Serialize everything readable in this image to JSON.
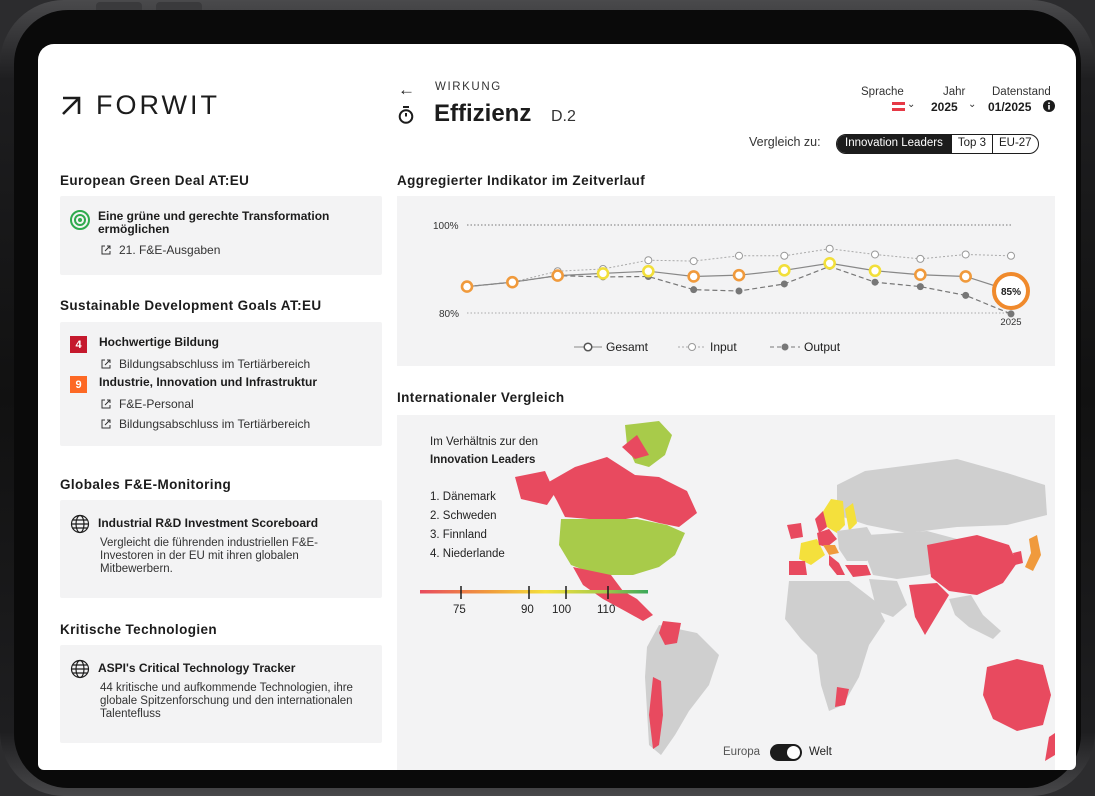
{
  "brand": {
    "name": "FORWIT"
  },
  "header": {
    "kicker": "WIRKUNG",
    "title": "Effizienz",
    "code": "D.2",
    "language_label": "Sprache",
    "year_label": "Jahr",
    "year_value": "2025",
    "data_label": "Datenstand",
    "data_value": "01/2025"
  },
  "compare": {
    "label": "Vergleich zu:",
    "options": [
      "Innovation Leaders",
      "Top 3",
      "EU-27"
    ],
    "selected": "Innovation Leaders"
  },
  "sidebar": {
    "green_deal": {
      "title": "European Green Deal AT:EU",
      "goal": "Eine grüne und gerechte Transformation ermöglichen",
      "link": "21. F&E-Ausgaben"
    },
    "sdg": {
      "title": "Sustainable Development Goals AT:EU",
      "goals": [
        {
          "num": "4",
          "label": "Hochwertige Bildung",
          "color": "#c5192d",
          "links": [
            "Bildungsabschluss im Tertiärbereich"
          ]
        },
        {
          "num": "9",
          "label": "Industrie, Innovation und Infrastruktur",
          "color": "#fd6925",
          "links": [
            "F&E-Personal",
            "Bildungsabschluss im Tertiärbereich"
          ]
        }
      ]
    },
    "monitoring": {
      "title": "Globales F&E-Monitoring",
      "item_title": "Industrial R&D Investment Scoreboard",
      "item_text": "Vergleicht die führenden industriellen F&E-Investoren in der EU mit ihren globalen Mitbewerbern."
    },
    "tech": {
      "title": "Kritische Technologien",
      "item_title": "ASPI's Critical Technology Tracker",
      "item_text": "44 kritische und aufkommende Technologien, ihre globale Spitzenforschung und den internationalen Talentefluss"
    }
  },
  "chart_data": {
    "type": "line",
    "title": "Aggregierter Indikator im Zeitverlauf",
    "y_ticks": [
      "100%",
      "80%"
    ],
    "ylim": [
      78,
      102
    ],
    "highlight_label": "85%",
    "year_label": "2025",
    "series": [
      {
        "name": "Gesamt",
        "values": [
          86,
          87,
          88.5,
          89,
          89.5,
          88.3,
          88.6,
          89.7,
          91.3,
          89.6,
          88.7,
          88.3,
          85
        ]
      },
      {
        "name": "Input",
        "values": [
          86,
          87,
          89.5,
          90,
          92,
          91.8,
          93,
          93,
          94.6,
          93.3,
          92.3,
          93.3,
          93
        ]
      },
      {
        "name": "Output",
        "values": [
          86,
          87,
          88.5,
          88.2,
          88.3,
          85.3,
          85,
          86.6,
          90.6,
          87,
          86,
          84,
          79.8
        ]
      }
    ],
    "colors": {
      "Gesamt": "#888888",
      "Input": "#a8a8a8",
      "Output": "#777777"
    }
  },
  "map": {
    "title": "Internationaler Vergleich",
    "intro": "Im Verhältnis zur den",
    "group": "Innovation Leaders",
    "ranking": [
      "1. Dänemark",
      "2. Schweden",
      "3. Finnland",
      "4. Niederlande"
    ],
    "scale_ticks": [
      "75",
      "90",
      "100",
      "110"
    ],
    "toggle_left": "Europa",
    "toggle_right": "Welt",
    "colors": {
      "red": "#e84a5f",
      "green": "#a8cb4a",
      "yellow": "#f4e03c",
      "orange": "#f09a3c",
      "grey": "#cfcfcf"
    }
  }
}
